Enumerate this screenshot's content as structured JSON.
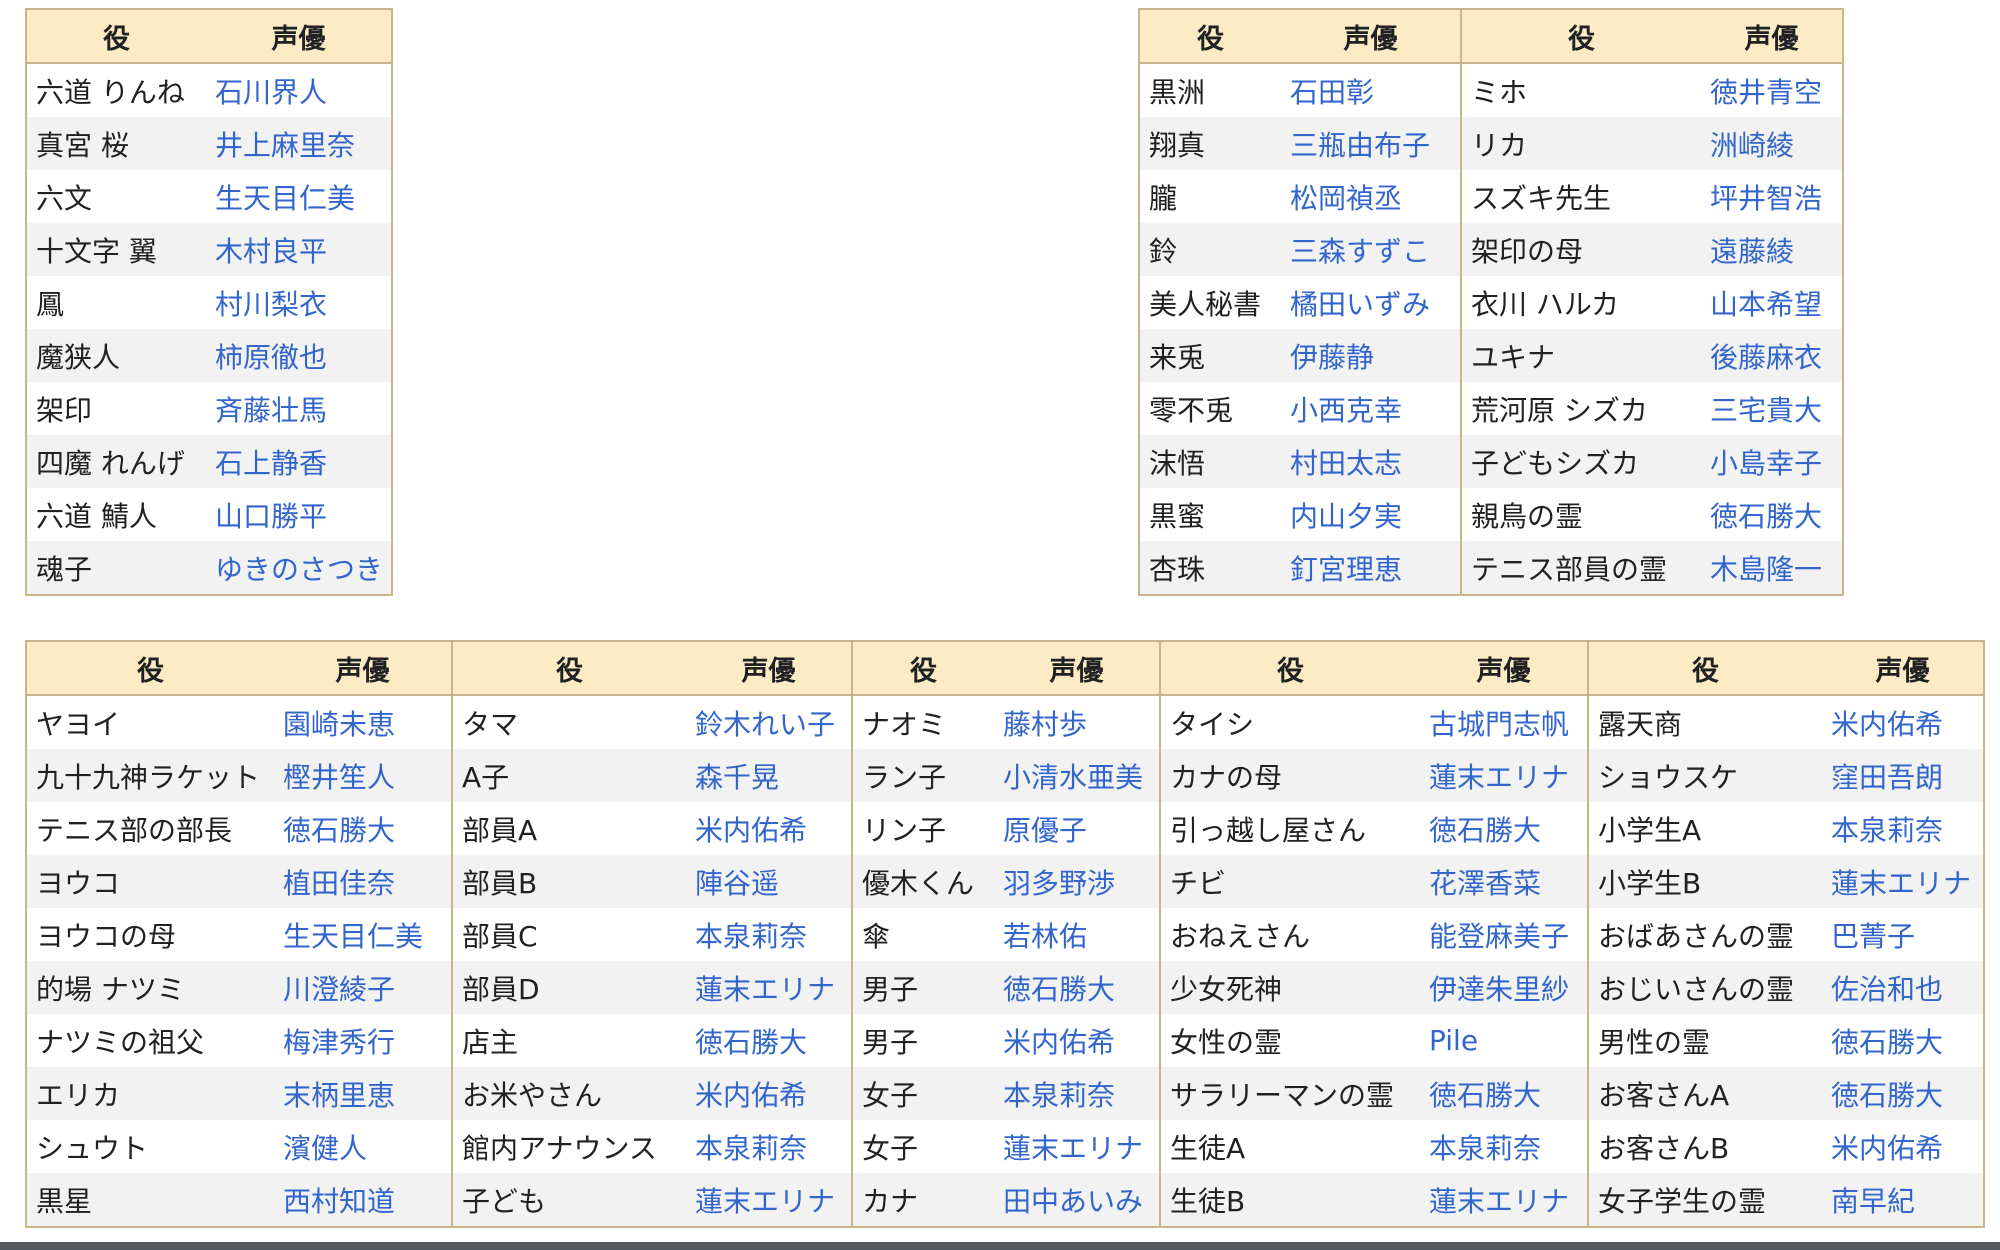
{
  "table1": {
    "headers": [
      "役",
      "声優"
    ],
    "rows": [
      [
        "六道 りんね",
        "石川界人"
      ],
      [
        "真宮 桜",
        "井上麻里奈"
      ],
      [
        "六文",
        "生天目仁美"
      ],
      [
        "十文字 翼",
        "木村良平"
      ],
      [
        "鳳",
        "村川梨衣"
      ],
      [
        "魔狭人",
        "柿原徹也"
      ],
      [
        "架印",
        "斉藤壮馬"
      ],
      [
        "四魔 れんげ",
        "石上静香"
      ],
      [
        "六道 鯖人",
        "山口勝平"
      ],
      [
        "魂子",
        "ゆきのさつき"
      ]
    ]
  },
  "table2": {
    "headers": [
      "役",
      "声優",
      "役",
      "声優"
    ],
    "rows": [
      [
        "黒洲",
        "石田彰",
        "ミホ",
        "徳井青空"
      ],
      [
        "翔真",
        "三瓶由布子",
        "リカ",
        "洲崎綾"
      ],
      [
        "朧",
        "松岡禎丞",
        "スズキ先生",
        "坪井智浩"
      ],
      [
        "鈴",
        "三森すずこ",
        "架印の母",
        "遠藤綾"
      ],
      [
        "美人秘書",
        "橘田いずみ",
        "衣川 ハルカ",
        "山本希望"
      ],
      [
        "来兎",
        "伊藤静",
        "ユキナ",
        "後藤麻衣"
      ],
      [
        "零不兎",
        "小西克幸",
        "荒河原 シズカ",
        "三宅貴大"
      ],
      [
        "沫悟",
        "村田太志",
        "子どもシズカ",
        "小島幸子"
      ],
      [
        "黒蜜",
        "内山夕実",
        "親鳥の霊",
        "徳石勝大"
      ],
      [
        "杏珠",
        "釘宮理恵",
        "テニス部員の霊",
        "木島隆一"
      ]
    ]
  },
  "table3": {
    "headers": [
      "役",
      "声優",
      "役",
      "声優",
      "役",
      "声優",
      "役",
      "声優",
      "役",
      "声優"
    ],
    "rows": [
      [
        "ヤヨイ",
        "園崎未恵",
        "タマ",
        "鈴木れい子",
        "ナオミ",
        "藤村歩",
        "タイシ",
        "古城門志帆",
        "露天商",
        "米内佑希"
      ],
      [
        "九十九神ラケット",
        "樫井笙人",
        "A子",
        "森千晃",
        "ラン子",
        "小清水亜美",
        "カナの母",
        "蓮末エリナ",
        "ショウスケ",
        "窪田吾朗"
      ],
      [
        "テニス部の部長",
        "徳石勝大",
        "部員A",
        "米内佑希",
        "リン子",
        "原優子",
        "引っ越し屋さん",
        "徳石勝大",
        "小学生A",
        "本泉莉奈"
      ],
      [
        "ヨウコ",
        "植田佳奈",
        "部員B",
        "陣谷遥",
        "優木くん",
        "羽多野渉",
        "チビ",
        "花澤香菜",
        "小学生B",
        "蓮末エリナ"
      ],
      [
        "ヨウコの母",
        "生天目仁美",
        "部員C",
        "本泉莉奈",
        "傘",
        "若林佑",
        "おねえさん",
        "能登麻美子",
        "おばあさんの霊",
        "巴菁子"
      ],
      [
        "的場 ナツミ",
        "川澄綾子",
        "部員D",
        "蓮末エリナ",
        "男子",
        "徳石勝大",
        "少女死神",
        "伊達朱里紗",
        "おじいさんの霊",
        "佐治和也"
      ],
      [
        "ナツミの祖父",
        "梅津秀行",
        "店主",
        "徳石勝大",
        "男子",
        "米内佑希",
        "女性の霊",
        "Pile",
        "男性の霊",
        "徳石勝大"
      ],
      [
        "エリカ",
        "末柄里恵",
        "お米やさん",
        "米内佑希",
        "女子",
        "本泉莉奈",
        "サラリーマンの霊",
        "徳石勝大",
        "お客さんA",
        "徳石勝大"
      ],
      [
        "シュウト",
        "濱健人",
        "館内アナウンス",
        "本泉莉奈",
        "女子",
        "蓮末エリナ",
        "生徒A",
        "本泉莉奈",
        "お客さんB",
        "米内佑希"
      ],
      [
        "黒星",
        "西村知道",
        "子ども",
        "蓮末エリナ",
        "カナ",
        "田中あいみ",
        "生徒B",
        "蓮末エリナ",
        "女子学生の霊",
        "南早紀"
      ]
    ]
  },
  "colors": {
    "header_bg": "#fcebc5",
    "border": "#c8b58a",
    "stripe": "#f2f2f2",
    "link": "#3366cc",
    "text": "#202122"
  }
}
